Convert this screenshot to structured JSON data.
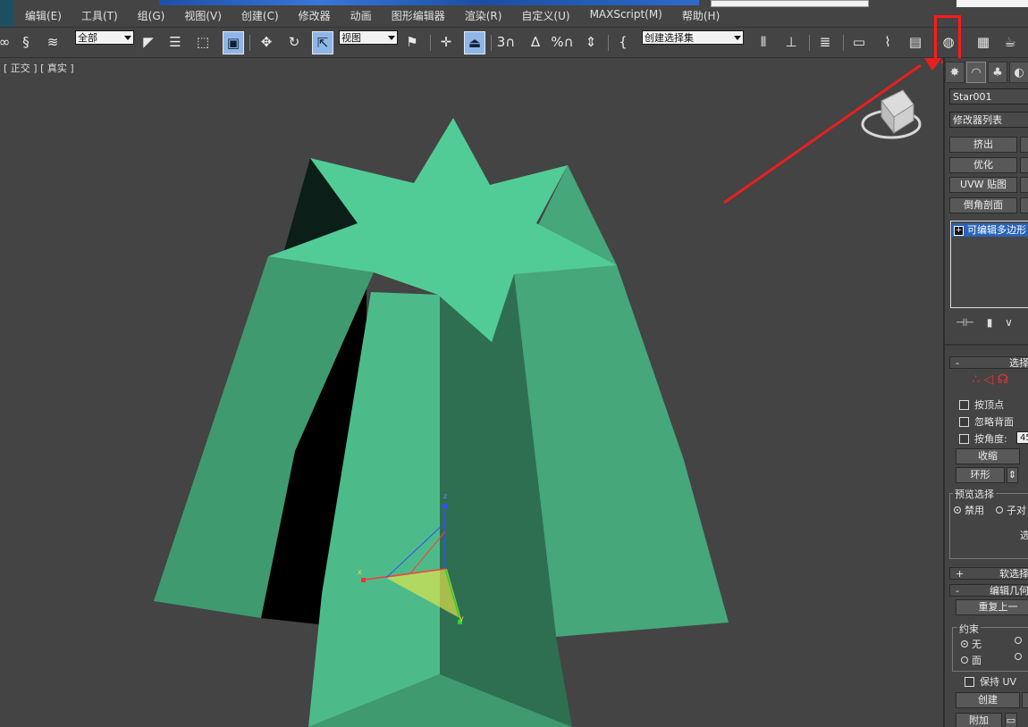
{
  "menu": {
    "items": [
      "编辑(E)",
      "工具(T)",
      "组(G)",
      "视图(V)",
      "创建(C)",
      "修改器",
      "动画",
      "图形编辑器",
      "渲染(R)",
      "自定义(U)",
      "MAXScript(M)",
      "帮助(H)"
    ]
  },
  "toolbar": {
    "selection_filter": "全部",
    "ref_coord": "视图",
    "named_selection": "创建选择集",
    "snap_3": "3",
    "snap_percent": "%",
    "highlighted_tool": "render-setup-icon"
  },
  "viewport": {
    "label": "[ 正交 ] [ 真实 ]",
    "axis_x": "x",
    "axis_y": "y",
    "axis_z": "z",
    "object_color": "#52cc96",
    "background": "#444444"
  },
  "panel": {
    "object_name": "Star001",
    "modifier_list": "修改器列表",
    "buttons": [
      "挤出",
      "优化",
      "UVW 贴图",
      "倒角剖面"
    ],
    "stack_item": "可编辑多边形",
    "rollout_select": "选择",
    "by_vertex": "按顶点",
    "ignore_backface": "忽略背面",
    "by_angle": "按角度:",
    "by_angle_value": "45",
    "shrink": "收缩",
    "ring": "环形",
    "preview_selection": "预览选择",
    "disabled": "禁用",
    "sub_object": "子对",
    "select_text": "选",
    "soft_selection": "软选择",
    "edit_geometry": "编辑几何",
    "repeat_last": "重复上一",
    "constraints": "约束",
    "none": "无",
    "face": "面",
    "preserve_uv": "保持 UV",
    "create": "创建",
    "attach": "附加"
  }
}
